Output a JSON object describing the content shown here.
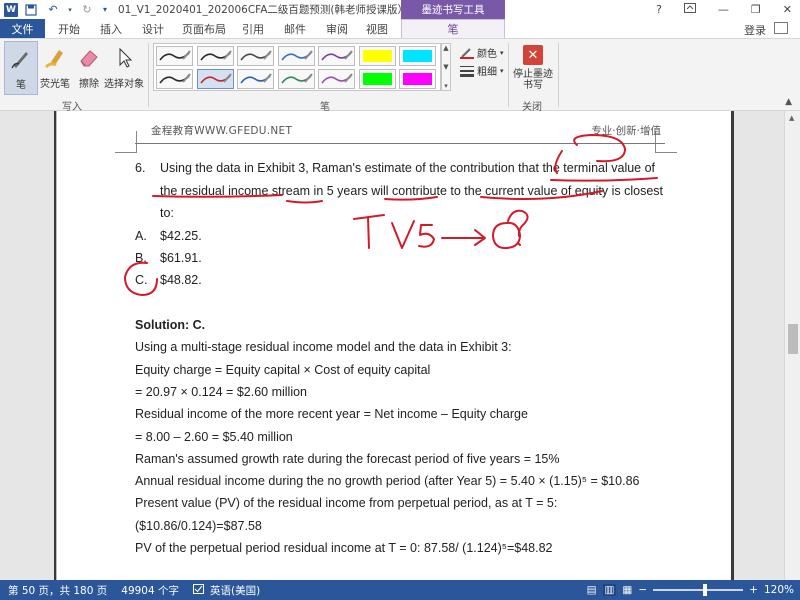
{
  "titlebar": {
    "word_logo": "W",
    "title": "01_V1_2020401_202006CFA二级百题预测(韩老师授课版）- ...",
    "tool_tab_caption": "墨迹书写工具",
    "help": "?",
    "minimize": "—",
    "restore": "❐",
    "close": "✕"
  },
  "tabs": {
    "file": "文件",
    "items": [
      "开始",
      "插入",
      "设计",
      "页面布局",
      "引用",
      "邮件",
      "审阅",
      "视图",
      "笔"
    ],
    "login": "登录"
  },
  "ribbon": {
    "write_group": {
      "label": "写入",
      "pen": "笔",
      "highlighter": "荧光笔",
      "eraser": "擦除",
      "select": "选择对象"
    },
    "pens_group": {
      "label": "笔",
      "swatches": [
        {
          "color": "#2a2a2a",
          "kind": "pen"
        },
        {
          "color": "#2a2a2a",
          "kind": "pen"
        },
        {
          "color": "#4a4a4a",
          "kind": "pen"
        },
        {
          "color": "#3a6fb5",
          "kind": "pen"
        },
        {
          "color": "#7a3fa0",
          "kind": "pen"
        },
        {
          "color": "#ffff00",
          "kind": "highlighter"
        },
        {
          "color": "#00e5ff",
          "kind": "highlighter"
        },
        {
          "color": "#2a2a2a",
          "kind": "pen"
        },
        {
          "color": "#c0282d",
          "kind": "pen"
        },
        {
          "color": "#2f5fb0",
          "kind": "pen"
        },
        {
          "color": "#2e8b57",
          "kind": "pen"
        },
        {
          "color": "#9a4fb0",
          "kind": "pen"
        },
        {
          "color": "#00ff00",
          "kind": "highlighter"
        },
        {
          "color": "#ff00ff",
          "kind": "highlighter"
        }
      ],
      "color_label": "颜色",
      "weight_label": "粗细"
    },
    "close_group": {
      "label": "关闭",
      "stop_label": "停止墨迹书写"
    }
  },
  "document": {
    "header_left": "金程教育WWW.GFEDU.NET",
    "header_right": "专业·创新·增值",
    "question": {
      "number": "6.",
      "line1": "Using the data in Exhibit 3, Raman's estimate of the contribution that the terminal value of",
      "line2": "the residual income stream in 5 years will contribute to the current value of equity is closest",
      "line3": "to:",
      "options": [
        {
          "letter": "A.",
          "text": "$42.25."
        },
        {
          "letter": "B.",
          "text": "$61.91."
        },
        {
          "letter": "C.",
          "text": "$48.82."
        }
      ]
    },
    "handwriting": {
      "tv5": "TV5 →0",
      "question_mark": "?"
    },
    "solution": {
      "heading": "Solution: C.",
      "lines": [
        "Using a multi-stage residual income model and the data in Exhibit 3:",
        "Equity charge = Equity capital × Cost of equity capital",
        "= 20.97 × 0.124 = $2.60 million",
        "Residual income of the more recent year = Net income – Equity charge",
        "= 8.00 – 2.60 = $5.40 million",
        "Raman's assumed growth rate during the forecast period of five years = 15%",
        "Annual residual income during the no growth period (after Year 5) = 5.40 × (1.15)⁵ = $10.86",
        "Present value (PV) of the residual income from perpetual period, as at T = 5:",
        "($10.86/0.124)=$87.58",
        "PV of the perpetual period residual income at T = 0: 87.58/ (1.124)⁵=$48.82"
      ]
    }
  },
  "statusbar": {
    "page": "第 50 页，共 180 页",
    "words": "49904 个字",
    "lang": "英语(美国)",
    "zoom": "120%",
    "zoom_minus": "−",
    "zoom_plus": "+"
  },
  "colors": {
    "accent": "#2b579a",
    "tool_tab": "#7a58a8",
    "ink": "#d11a2a"
  }
}
